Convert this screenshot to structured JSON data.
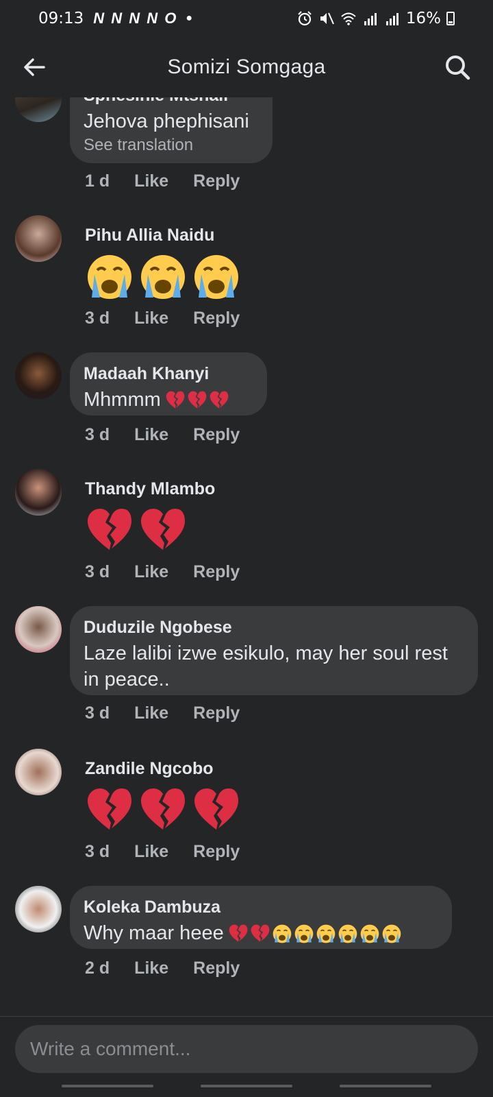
{
  "status_bar": {
    "time": "09:13",
    "notification_icons": "N N N N O",
    "battery": "16%"
  },
  "header": {
    "title": "Somizi Somgaga"
  },
  "comments": [
    {
      "name": "Sphesihle Mtshali",
      "text": "Jehova phephisani",
      "see_translation": "See translation",
      "time": "1 d",
      "like": "Like",
      "reply": "Reply"
    },
    {
      "name": "Pihu Allia Naidu",
      "emojis": [
        "crying-face",
        "crying-face",
        "crying-face"
      ],
      "time": "3 d",
      "like": "Like",
      "reply": "Reply"
    },
    {
      "name": "Madaah Khanyi",
      "text": "Mhmmm",
      "inline_emojis": [
        "broken-heart",
        "broken-heart",
        "broken-heart"
      ],
      "time": "3 d",
      "like": "Like",
      "reply": "Reply"
    },
    {
      "name": "Thandy Mlambo",
      "emojis": [
        "broken-heart",
        "broken-heart"
      ],
      "time": "3 d",
      "like": "Like",
      "reply": "Reply"
    },
    {
      "name": "Duduzile Ngobese",
      "text_line1": "Laze lalibi izwe esikulo, may her soul rest",
      "text_line2": "in peace..",
      "time": "3 d",
      "like": "Like",
      "reply": "Reply"
    },
    {
      "name": "Zandile Ngcobo",
      "emojis": [
        "broken-heart",
        "broken-heart",
        "broken-heart"
      ],
      "time": "3 d",
      "like": "Like",
      "reply": "Reply"
    },
    {
      "name": "Koleka Dambuza",
      "text": "Why maar heee",
      "inline_emojis": [
        "broken-heart",
        "broken-heart",
        "crying-face",
        "crying-face",
        "crying-face",
        "crying-face",
        "crying-face",
        "crying-face"
      ],
      "time": "2 d",
      "like": "Like",
      "reply": "Reply"
    }
  ],
  "composer": {
    "placeholder": "Write a comment..."
  },
  "colors": {
    "background": "#242526",
    "bubble": "#3a3b3c",
    "text_primary": "#e4e6eb",
    "text_secondary": "#b0b3b8",
    "broken_heart": "#dd2e44",
    "crying_face": "#ffcc4d",
    "tears": "#5dadec"
  }
}
